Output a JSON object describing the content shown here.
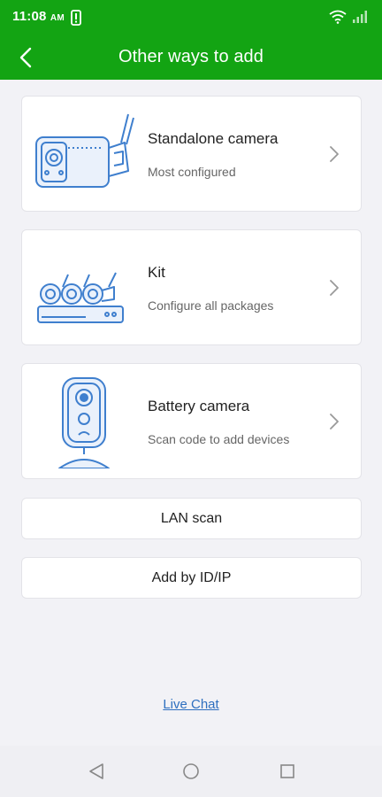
{
  "status_bar": {
    "time": "11:08",
    "ampm": "AM"
  },
  "app_bar": {
    "title": "Other ways to add"
  },
  "cards": [
    {
      "title": "Standalone camera",
      "subtitle": "Most configured",
      "icon": "bullet-camera-icon"
    },
    {
      "title": "Kit",
      "subtitle": "Configure all packages",
      "icon": "nvr-kit-icon"
    },
    {
      "title": "Battery camera",
      "subtitle": "Scan code to add devices",
      "icon": "battery-camera-icon"
    }
  ],
  "buttons": {
    "lan_scan": "LAN scan",
    "add_by_id": "Add by ID/IP"
  },
  "footer": {
    "live_chat": "Live Chat"
  },
  "colors": {
    "header_bg": "#13a413",
    "illustration": "#3f7fce",
    "link": "#2e6fbf"
  }
}
